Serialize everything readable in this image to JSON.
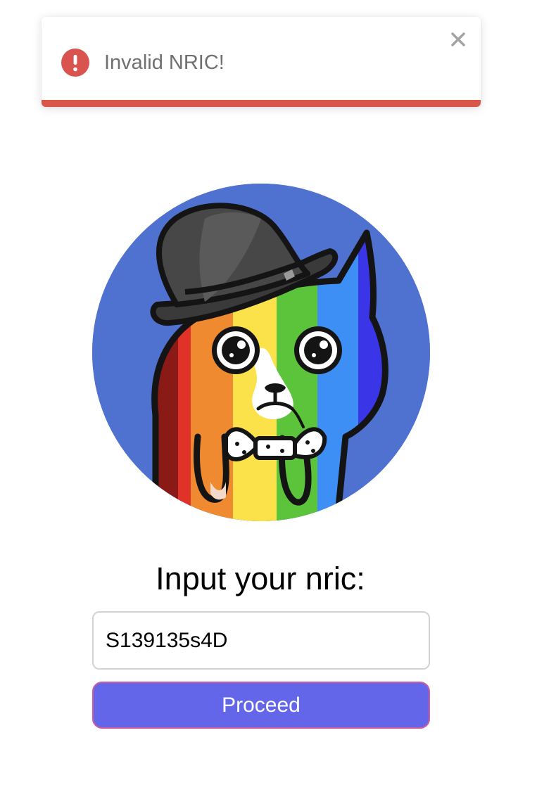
{
  "toast": {
    "message": "Invalid NRIC!",
    "icon": "error-exclamation-icon",
    "close_icon": "close-icon",
    "close_glyph": "✕",
    "status_color": "#d9534f",
    "progress_remaining": 1.0
  },
  "avatar": {
    "icon": "rainbow-cat-bowler-hat-avatar"
  },
  "form": {
    "prompt": "Input your nric:",
    "nric_value": "S139135s4D",
    "proceed_label": "Proceed"
  },
  "colors": {
    "button": "#6366e8",
    "button_border": "#d05c9e",
    "avatar_background": "#4f72d1"
  }
}
